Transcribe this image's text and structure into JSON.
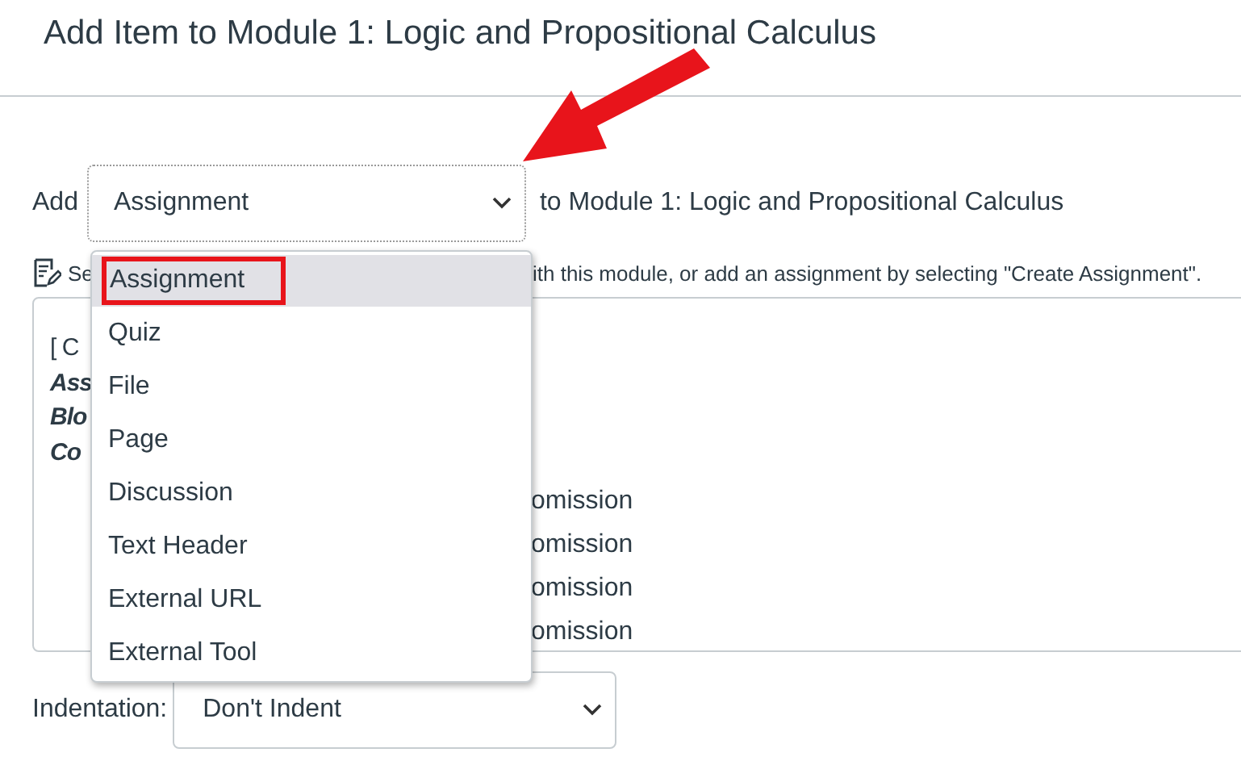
{
  "title": "Add Item to Module 1: Logic and Propositional Calculus",
  "add_label": "Add",
  "type_select": {
    "value": "Assignment"
  },
  "to_module_text": "to Module 1: Logic and Propositional Calculus",
  "description": {
    "left": "Se",
    "right": "ith this module, or add an assignment by selecting \"Create Assignment\"."
  },
  "listbox": {
    "left_lines": [
      {
        "text": "[ C",
        "kind": "plain"
      },
      {
        "text": "Ass",
        "kind": "heading"
      },
      {
        "text": "Blo",
        "kind": "heading"
      },
      {
        "text": "Co",
        "kind": "heading"
      }
    ],
    "right_lines": [
      "omission",
      "omission",
      "omission",
      "omission"
    ]
  },
  "menu": {
    "options": [
      {
        "label": "Assignment",
        "selected": true
      },
      {
        "label": "Quiz",
        "selected": false
      },
      {
        "label": "File",
        "selected": false
      },
      {
        "label": "Page",
        "selected": false
      },
      {
        "label": "Discussion",
        "selected": false
      },
      {
        "label": "Text Header",
        "selected": false
      },
      {
        "label": "External URL",
        "selected": false
      },
      {
        "label": "External Tool",
        "selected": false
      }
    ]
  },
  "indentation": {
    "label": "Indentation:",
    "value": "Don't Indent"
  },
  "annotations": [
    {
      "kind": "arrow"
    }
  ]
}
